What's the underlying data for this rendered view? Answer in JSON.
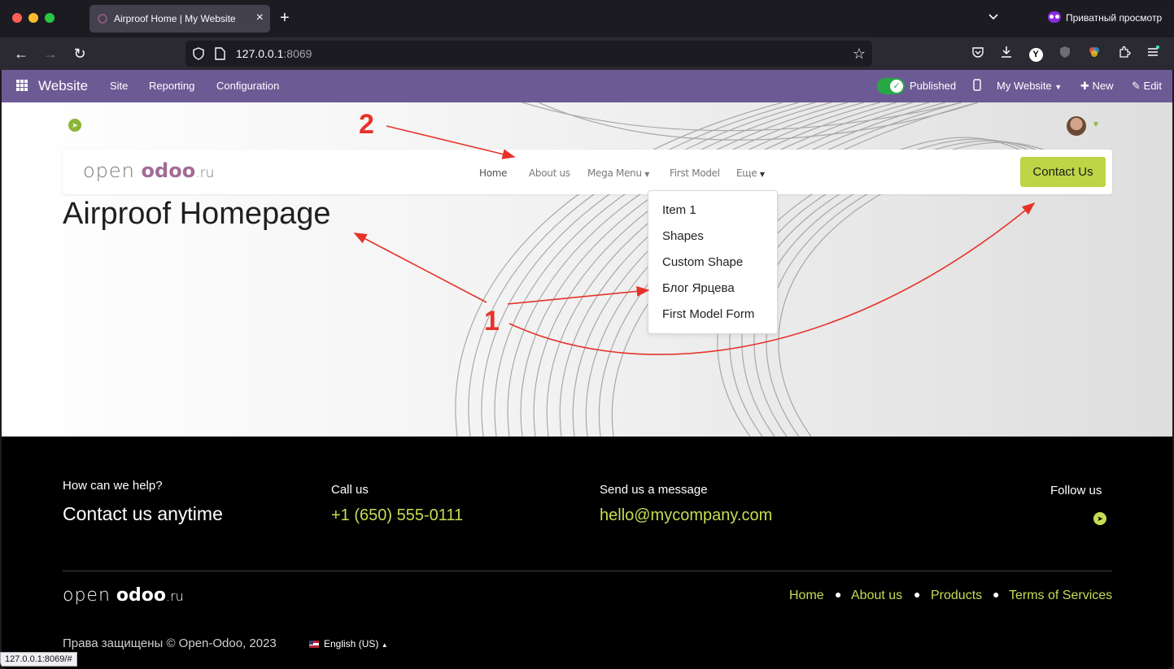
{
  "browser": {
    "tab_title": "Airproof Home | My Website",
    "url_host": "127.0.0.1",
    "url_port": ":8069",
    "private_label": "Приватный просмотр",
    "status_url": "127.0.0.1:8069/#"
  },
  "admin_bar": {
    "app_name": "Website",
    "menu": [
      "Site",
      "Reporting",
      "Configuration"
    ],
    "published_label": "Published",
    "website_selector": "My Website",
    "new_label": "New",
    "edit_label": "Edit"
  },
  "header": {
    "logo_open": "open",
    "logo_odoo": "odoo",
    "logo_tld": ".ru",
    "menu": {
      "home": "Home",
      "about": "About us",
      "mega": "Mega Menu",
      "first_model": "First Model",
      "more": "Еще"
    },
    "contact_button": "Contact Us"
  },
  "dropdown": {
    "items": [
      "Item 1",
      "Shapes",
      "Custom Shape",
      "Блог Ярцева",
      "First Model Form"
    ]
  },
  "hero": {
    "title": "Airproof Homepage"
  },
  "annotations": {
    "one": "1",
    "two": "2"
  },
  "footer": {
    "help_question": "How can we help?",
    "help_heading": "Contact us anytime",
    "call_label": "Call us",
    "phone": "+1 (650) 555-0111",
    "message_label": "Send us a message",
    "email": "hello@mycompany.com",
    "follow_label": "Follow us",
    "links": [
      "Home",
      "About us",
      "Products",
      "Terms of Services"
    ],
    "copyright": "Права защищены © Open-Odoo, 2023",
    "language": "English (US)"
  },
  "colors": {
    "admin_bar": "#6c5a95",
    "accent_lime": "#bed545",
    "annotation_red": "#e63329"
  }
}
